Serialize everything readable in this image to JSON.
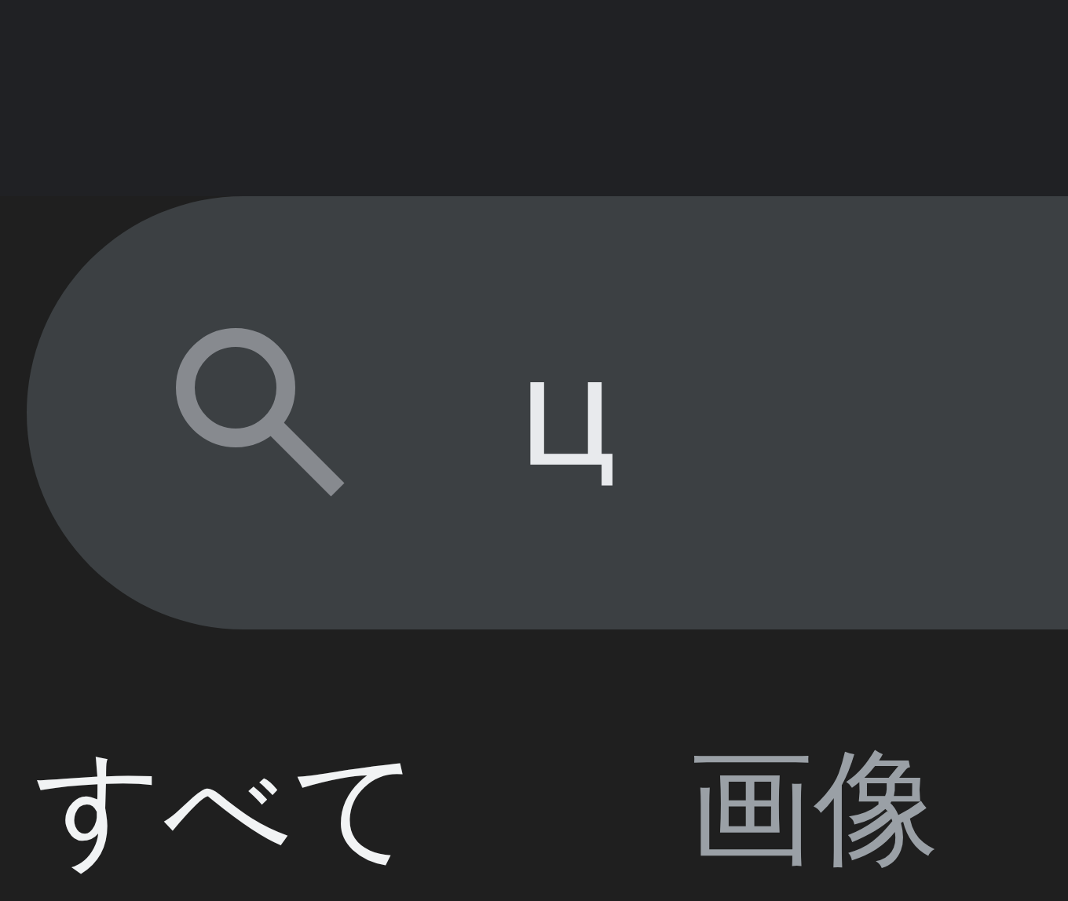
{
  "search": {
    "value": "ц"
  },
  "tabs": [
    {
      "label": "すべて",
      "selected": true
    },
    {
      "label": "画像",
      "selected": false
    }
  ]
}
